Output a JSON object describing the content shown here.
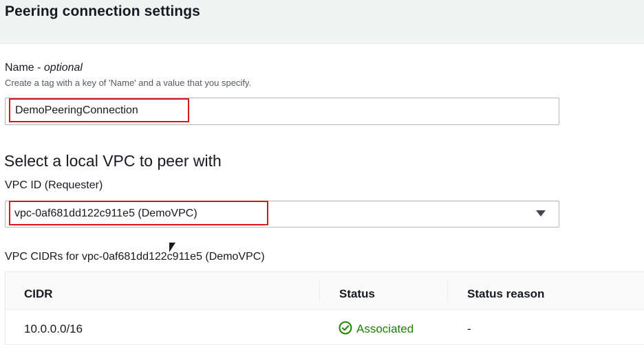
{
  "panel": {
    "title": "Peering connection settings"
  },
  "name_field": {
    "label": "Name - ",
    "label_optional": "optional",
    "description": "Create a tag with a key of 'Name' and a value that you specify.",
    "value": "DemoPeeringConnection"
  },
  "local_vpc": {
    "heading": "Select a local VPC to peer with",
    "vpc_id_label": "VPC ID (Requester)",
    "selected_value": "vpc-0af681dd122c911e5 (DemoVPC)",
    "caret_icon": "caret-down-icon"
  },
  "cidr_table": {
    "caption": "VPC CIDRs for vpc-0af681dd122c911e5 (DemoVPC)",
    "columns": [
      "CIDR",
      "Status",
      "Status reason"
    ],
    "rows": [
      {
        "cidr": "10.0.0.0/16",
        "status": "Associated",
        "status_icon": "check-circle-icon",
        "status_reason": "-"
      }
    ]
  },
  "colors": {
    "highlight": "#d91515",
    "success": "#1d8102",
    "header_bg": "#f2f3f3"
  }
}
